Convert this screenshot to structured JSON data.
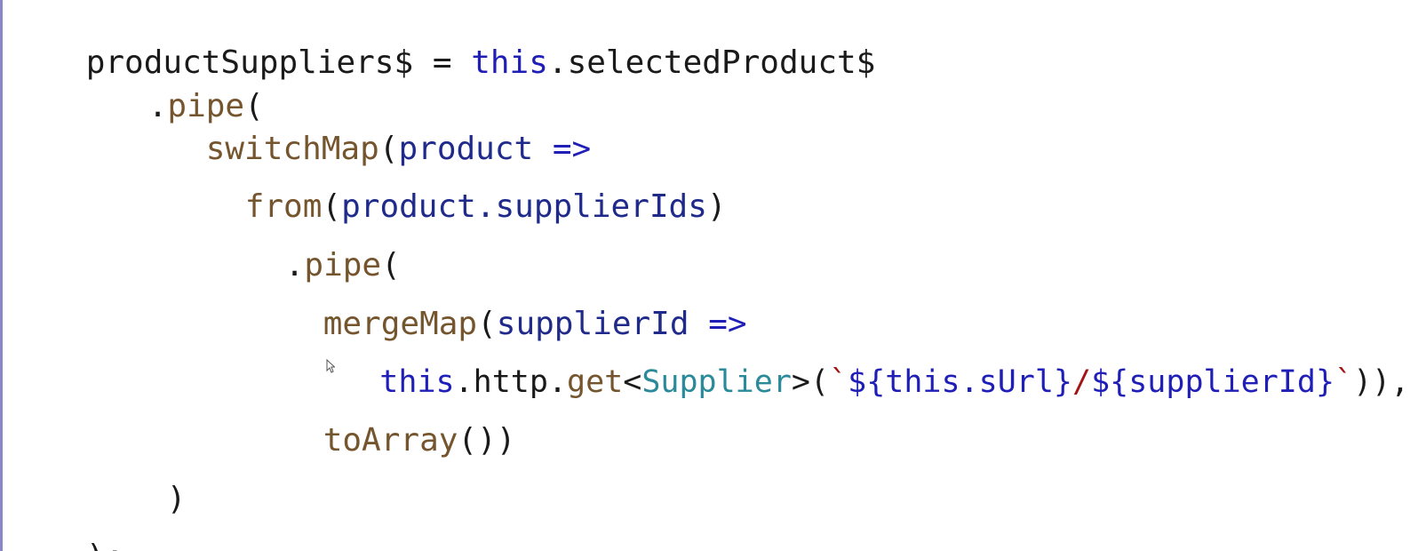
{
  "colors": {
    "default": "#1a1a1a",
    "keyword": "#1f1fb8",
    "method": "#75552e",
    "param": "#1f2a8a",
    "type": "#2b8a9a",
    "string": "#a31515",
    "gutter": "#8a86c7"
  },
  "code": {
    "line1": {
      "decl": "productSuppliers$ = ",
      "this": "this",
      "rest": ".selectedProduct$"
    },
    "line2": {
      "dot": ".",
      "pipe": "pipe",
      "paren": "("
    },
    "line3": {
      "switchMap": "switchMap",
      "paren": "(",
      "product": "product",
      "arrow": " =>"
    },
    "line4": {
      "from": "from",
      "paren": "(",
      "arg": "product.supplierIds",
      "close": ")"
    },
    "line5": {
      "dot": ".",
      "pipe": "pipe",
      "paren": "("
    },
    "line6": {
      "mergeMap": "mergeMap",
      "paren": "(",
      "supplierId": "supplierId",
      "arrow": " =>"
    },
    "line7": {
      "this": "this",
      "http": ".http.",
      "get": "get",
      "lt": "<",
      "type": "Supplier",
      "gt": ">(",
      "tick1": "`",
      "interp1": "${this.sUrl}",
      "slash": "/",
      "interp2": "${supplierId}",
      "tick2": "`",
      "close": ")),"
    },
    "line8": {
      "toArray": "toArray",
      "close": "())"
    },
    "line9": {
      "close": ")"
    },
    "line10": {
      "close": ");"
    }
  },
  "cursor_icon": "mouse-pointer-icon"
}
